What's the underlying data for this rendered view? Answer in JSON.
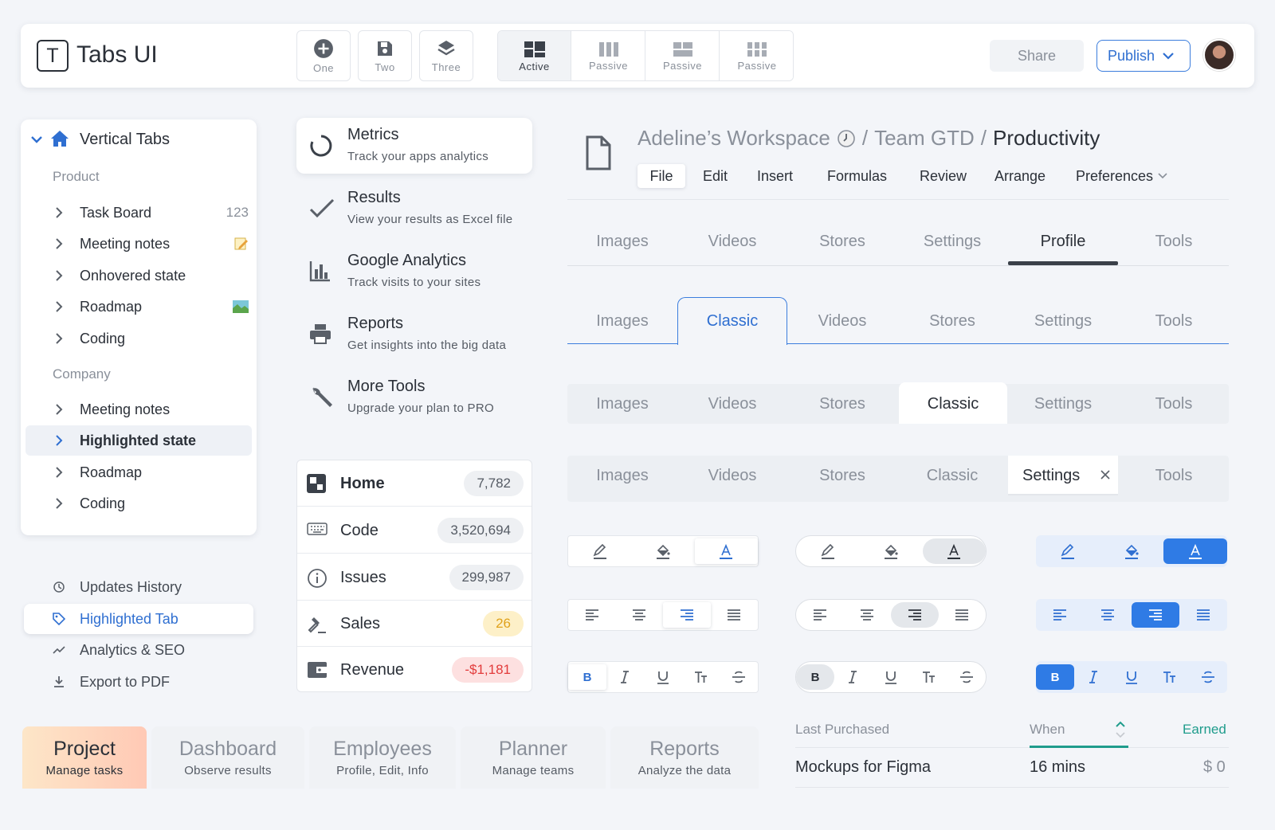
{
  "app": {
    "logo_letter": "T",
    "title": "Tabs UI"
  },
  "toolbar": {
    "buttons": [
      {
        "label": "One",
        "icon": "add-circle-icon"
      },
      {
        "label": "Two",
        "icon": "save-icon"
      },
      {
        "label": "Three",
        "icon": "layers-icon"
      }
    ],
    "toggle_group": [
      {
        "label": "Active",
        "icon": "dashboard-icon",
        "active": true
      },
      {
        "label": "Passive",
        "icon": "columns-icon",
        "active": false
      },
      {
        "label": "Passive",
        "icon": "grid-layout-icon",
        "active": false
      },
      {
        "label": "Passive",
        "icon": "apps-icon",
        "active": false
      }
    ],
    "share_label": "Share",
    "publish_label": "Publish"
  },
  "sidebar": {
    "title": "Vertical Tabs",
    "section_product": "Product",
    "product_items": [
      {
        "label": "Task Board",
        "count": "123"
      },
      {
        "label": "Meeting notes",
        "badge": "memo"
      },
      {
        "label": "Onhovered state"
      },
      {
        "label": "Roadmap",
        "badge": "map"
      },
      {
        "label": "Coding"
      }
    ],
    "section_company": "Company",
    "company_items": [
      {
        "label": "Meeting notes"
      },
      {
        "label": "Highlighted state",
        "highlighted": true
      },
      {
        "label": "Roadmap"
      },
      {
        "label": "Coding"
      }
    ]
  },
  "bottom_nav": [
    {
      "label": "Updates History",
      "icon": "history-icon"
    },
    {
      "label": "Highlighted Tab",
      "icon": "tag-icon",
      "highlighted": true
    },
    {
      "label": "Analytics & SEO",
      "icon": "trend-icon"
    },
    {
      "label": "Export to PDF",
      "icon": "download-icon"
    }
  ],
  "middle_list": [
    {
      "title": "Metrics",
      "subtitle": "Track your apps analytics",
      "icon": "loading-circle-icon",
      "active": true
    },
    {
      "title": "Results",
      "subtitle": "View your results as Excel file",
      "icon": "check-icon"
    },
    {
      "title": "Google Analytics",
      "subtitle": "Track visits to your sites",
      "icon": "bar-chart-icon"
    },
    {
      "title": "Reports",
      "subtitle": "Get insights into the big data",
      "icon": "printer-icon"
    },
    {
      "title": "More Tools",
      "subtitle": "Upgrade your plan to PRO",
      "icon": "wrench-icon"
    }
  ],
  "stats": [
    {
      "label": "Home",
      "value": "7,782",
      "icon": "home-app-icon",
      "bold": true
    },
    {
      "label": "Code",
      "value": "3,520,694",
      "icon": "keyboard-icon"
    },
    {
      "label": "Issues",
      "value": "299,987",
      "icon": "info-icon"
    },
    {
      "label": "Sales",
      "value": "26",
      "icon": "gavel-icon",
      "tone": "warning"
    },
    {
      "label": "Revenue",
      "value": "-$1,181",
      "icon": "wallet-icon",
      "tone": "danger"
    }
  ],
  "bottom_tabs": [
    {
      "title": "Project",
      "subtitle": "Manage tasks",
      "active": true
    },
    {
      "title": "Dashboard",
      "subtitle": "Observe results"
    },
    {
      "title": "Employees",
      "subtitle": "Profile, Edit, Info"
    },
    {
      "title": "Planner",
      "subtitle": "Manage teams"
    },
    {
      "title": "Reports",
      "subtitle": "Analyze the data"
    }
  ],
  "breadcrumb": {
    "workspace": "Adeline’s Workspace",
    "sep": "/",
    "team": "Team GTD",
    "current": "Productivity"
  },
  "menubar": [
    "File",
    "Edit",
    "Insert",
    "Formulas",
    "Review",
    "Arrange",
    "Preferences"
  ],
  "tab_rows": {
    "underline": [
      "Images",
      "Videos",
      "Stores",
      "Settings",
      "Profile",
      "Tools"
    ],
    "classic": [
      "Images",
      "Classic",
      "Videos",
      "Stores",
      "Settings",
      "Tools"
    ],
    "filled": [
      "Images",
      "Videos",
      "Stores",
      "Classic",
      "Settings",
      "Tools"
    ],
    "closable": [
      "Images",
      "Videos",
      "Stores",
      "Classic",
      "Settings",
      "Tools"
    ]
  },
  "table": {
    "headers": [
      "Last Purchased",
      "When",
      "Earned"
    ],
    "rows": [
      [
        "Mockups for Figma",
        "16 mins",
        "$ 0"
      ]
    ]
  },
  "colors": {
    "accent": "#2f6fd1",
    "accent_fill": "#2f7be5",
    "teal": "#1f9c8c",
    "warning_bg": "#fdf0c8",
    "danger_bg": "#fde0e0"
  }
}
